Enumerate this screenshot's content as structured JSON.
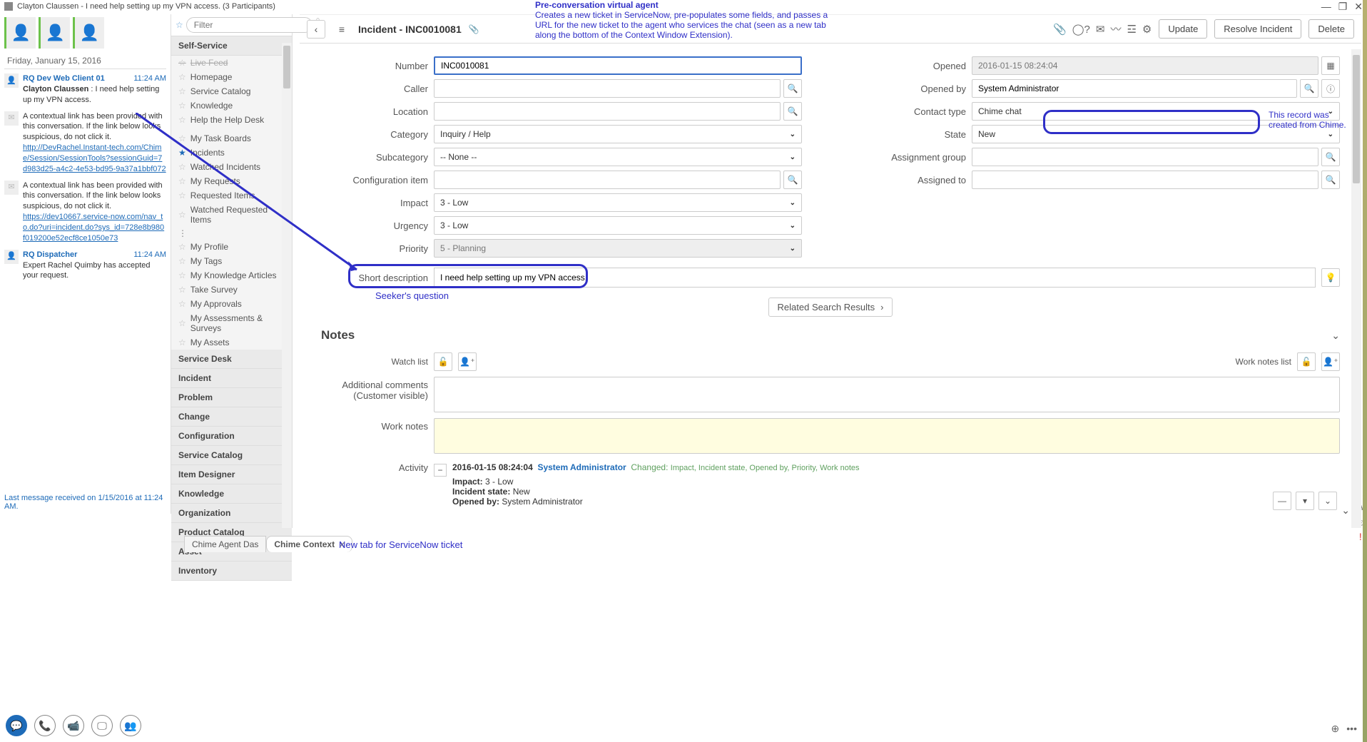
{
  "window": {
    "title": "Clayton Claussen - I need help setting up my VPN access. (3 Participants)"
  },
  "chat": {
    "date": "Friday, January 15, 2016",
    "footer": "Last message received on 1/15/2016 at 11:24 AM.",
    "messages": [
      {
        "from": "RQ Dev Web Client 01",
        "time": "11:24 AM",
        "author": "Clayton Claussen",
        "text": " : I need help setting up my VPN access."
      },
      {
        "from": "mail-icon",
        "text_prefix": "A contextual link has been provided with this conversation. If the link below looks suspicious, do not click it.",
        "link": "http://DevRachel.Instant-tech.com/Chime/Session/SessionTools?sessionGuid=7d983d25-a4c2-4e53-bd95-9a37a1bbf072"
      },
      {
        "from": "mail-icon",
        "text_prefix": "A contextual link has been provided with this conversation. If the link below looks suspicious, do not click it.",
        "link": "https://dev10667.service-now.com/nav_to.do?uri=incident.do?sys_id=728e8b980f019200e52ecf8ce1050e73"
      },
      {
        "from": "RQ Dispatcher",
        "time": "11:24 AM",
        "text": "Expert Rachel Quimby has accepted your request."
      }
    ]
  },
  "nav": {
    "filter_placeholder": "Filter",
    "sections": {
      "self_service": "Self-Service",
      "items1": [
        "Live Feed",
        "Homepage",
        "Service Catalog",
        "Knowledge",
        "Help the Help Desk"
      ],
      "items2": [
        "My Task Boards",
        "Incidents",
        "Watched Incidents",
        "My Requests",
        "Requested Items",
        "Watched Requested Items"
      ],
      "items3": [
        "My Profile",
        "My Tags",
        "My Knowledge Articles",
        "Take Survey",
        "My Approvals",
        "My Assessments & Surveys",
        "My Assets"
      ],
      "others": [
        "Service Desk",
        "Incident",
        "Problem",
        "Change",
        "Configuration",
        "Service Catalog",
        "Item Designer",
        "Knowledge",
        "Organization",
        "Product Catalog",
        "Asset",
        "Inventory"
      ]
    }
  },
  "form": {
    "title_prefix": "Incident - ",
    "title_id": "INC0010081",
    "buttons": {
      "update": "Update",
      "resolve": "Resolve Incident",
      "delete": "Delete"
    },
    "labels": {
      "number": "Number",
      "caller": "Caller",
      "location": "Location",
      "category": "Category",
      "subcategory": "Subcategory",
      "config_item": "Configuration item",
      "impact": "Impact",
      "urgency": "Urgency",
      "priority": "Priority",
      "opened": "Opened",
      "opened_by": "Opened by",
      "contact_type": "Contact type",
      "state": "State",
      "assignment_group": "Assignment group",
      "assigned_to": "Assigned to",
      "short_desc": "Short description"
    },
    "values": {
      "number": "INC0010081",
      "category": "Inquiry / Help",
      "subcategory": "-- None --",
      "impact": "3 - Low",
      "urgency": "3 - Low",
      "priority": "5 - Planning",
      "opened": "2016-01-15 08:24:04",
      "opened_by": "System Administrator",
      "contact_type": "Chime chat",
      "state": "New",
      "short_desc": "I need help setting up my VPN access."
    },
    "related": "Related Search Results"
  },
  "notes": {
    "heading": "Notes",
    "watch_list": "Watch list",
    "work_notes_list": "Work notes list",
    "additional_comments": "Additional comments (Customer visible)",
    "work_notes": "Work notes",
    "activity": "Activity",
    "activity_entry": {
      "timestamp": "2016-01-15 08:24:04",
      "who": "System Administrator",
      "changed_label": "Changed:",
      "changed_fields": "Impact, Incident state, Opened by, Priority, Work notes",
      "kv": [
        {
          "k": "Impact:",
          "v": "3 - Low"
        },
        {
          "k": "Incident state:",
          "v": "New"
        },
        {
          "k": "Opened by:",
          "v": "System Administrator"
        }
      ]
    }
  },
  "annotations": {
    "pre_title": "Pre-conversation virtual agent",
    "pre_body": "Creates a new ticket in ServiceNow, pre-populates some fields, and passes a URL for the new ticket to the agent who services the chat (seen as a new tab along the bottom of the Context Window Extension).",
    "side": "This record was created from Chime.",
    "seeker": "Seeker's question",
    "newtab": "New tab for ServiceNow ticket"
  },
  "tabs": {
    "dashboard": "Chime Agent Das",
    "context": "Chime Context"
  }
}
